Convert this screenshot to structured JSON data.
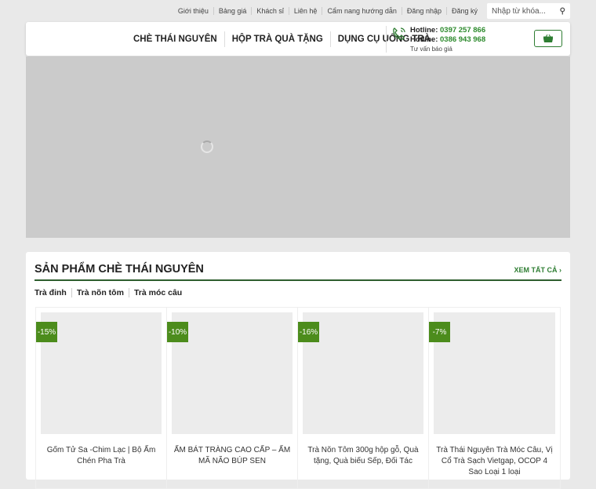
{
  "topbar": {
    "links": [
      "Giới thiệu",
      "Bảng giá",
      "Khách sỉ",
      "Liên hệ",
      "Cẩm nang hướng dẫn",
      "Đăng nhập",
      "Đăng ký"
    ],
    "search_placeholder": "Nhập từ khóa..."
  },
  "nav": [
    "CHÈ THÁI NGUYÊN",
    "HỘP TRÀ QUÀ TẶNG",
    "DỤNG CỤ UỐNG TRÀ"
  ],
  "hotline": {
    "label": "Hotline:",
    "phone1": "0397 257 866",
    "phone2": "0386 943 968",
    "sub": "Tư vấn báo giá"
  },
  "section": {
    "title": "SẢN PHẨM CHÈ THÁI NGUYÊN",
    "see_all": "XEM TẤT CẢ",
    "tabs": [
      "Trà đinh",
      "Trà nõn tôm",
      "Trà móc câu"
    ],
    "products": [
      {
        "discount": "-15%",
        "name": "Gốm Tử Sa -Chim Lạc | Bộ Ấm Chén Pha Trà"
      },
      {
        "discount": "-10%",
        "name": "ẤM BÁT TRÀNG CAO CẤP – ẤM MÃ NÃO BÚP SEN"
      },
      {
        "discount": "-16%",
        "name": "Trà Nõn Tôm 300g hộp gỗ, Quà tặng, Quà biếu Sếp, Đối Tác"
      },
      {
        "discount": "-7%",
        "name": "Trà Thái Nguyên Trà Móc Câu, Vị Cổ Trà Sạch Vietgap, OCOP 4 Sao Loại 1 loại"
      }
    ]
  }
}
